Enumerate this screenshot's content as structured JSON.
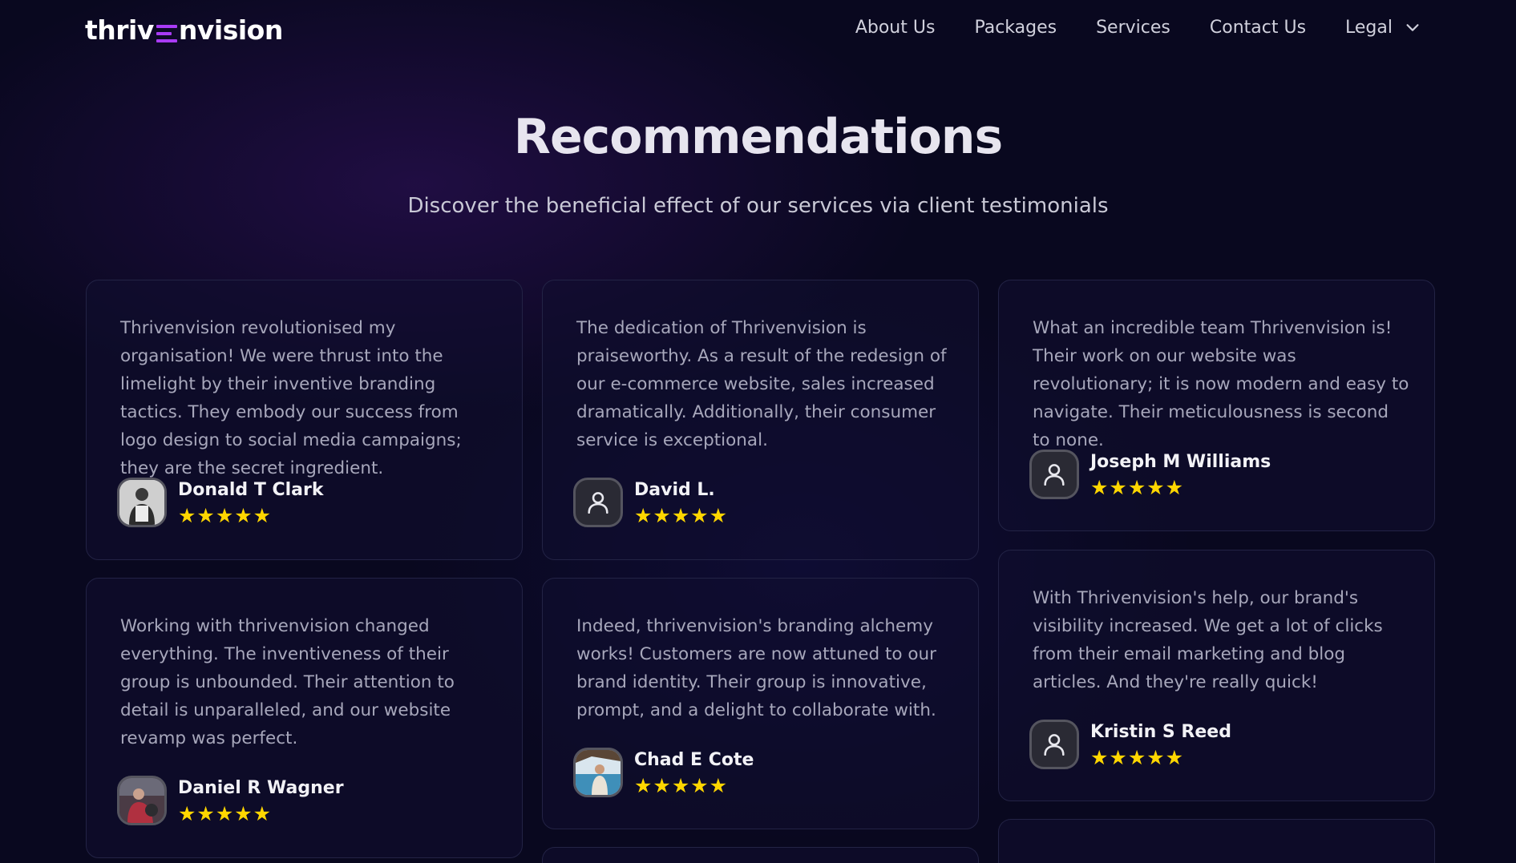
{
  "nav": {
    "logo_part1": "thriv",
    "logo_part2": "nvision",
    "links": [
      "About Us",
      "Packages",
      "Services",
      "Contact Us",
      "Legal"
    ]
  },
  "header": {
    "title": "Recommendations",
    "subtitle": "Discover the beneficial effect of our services via client testimonials"
  },
  "colors": {
    "background": "#09081f",
    "accent": "#a93bf5",
    "star": "#ffd600"
  },
  "stars_display": "★★★★★",
  "testimonials": [
    {
      "text": "Thrivenvision revolutionised my organisation! We were thrust into the limelight by their inventive branding tactics. They embody our success from logo design to social media campaigns; they are the secret ingredient.",
      "name": "Donald T Clark",
      "rating": 5,
      "avatar": "photo"
    },
    {
      "text": "The dedication of Thrivenvision is praiseworthy. As a result of the redesign of our e-commerce website, sales increased dramatically. Additionally, their consumer service is exceptional.",
      "name": "David L.",
      "rating": 5,
      "avatar": "user-icon"
    },
    {
      "text": "What an incredible team Thrivenvision is! Their work on our website was revolutionary; it is now modern and easy to navigate. Their meticulousness is second to none.",
      "name": "Joseph M Williams",
      "rating": 5,
      "avatar": "user-icon"
    },
    {
      "text": "Working with thrivenvision changed everything. The inventiveness of their group is unbounded. Their attention to detail is unparalleled, and our website revamp was perfect.",
      "name": "Daniel R Wagner",
      "rating": 5,
      "avatar": "photo"
    },
    {
      "text": "Indeed, thrivenvision's branding alchemy works! Customers are now attuned to our brand identity. Their group is innovative, prompt, and a delight to collaborate with.",
      "name": "Chad E Cote",
      "rating": 5,
      "avatar": "photo"
    },
    {
      "text": "With Thrivenvision's help, our brand's visibility increased. We get a lot of clicks from their email marketing and blog articles. And they're really quick!",
      "name": "Kristin S Reed",
      "rating": 5,
      "avatar": "user-icon"
    }
  ]
}
